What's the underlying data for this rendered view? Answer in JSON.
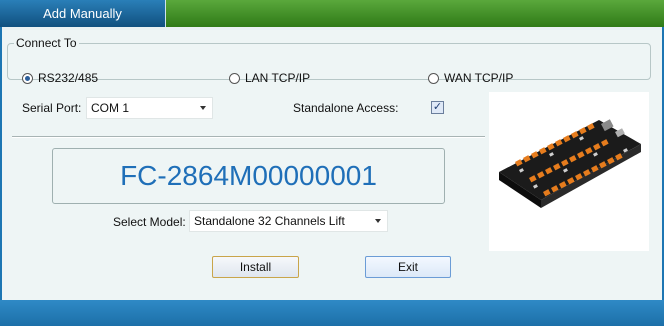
{
  "window": {
    "tab_title": "Add Manually"
  },
  "connect": {
    "legend": "Connect To",
    "options": [
      {
        "label": "RS232/485",
        "selected": true
      },
      {
        "label": "LAN TCP/IP",
        "selected": false
      },
      {
        "label": "WAN TCP/IP",
        "selected": false
      }
    ]
  },
  "serial": {
    "label": "Serial Port:",
    "value": "COM 1"
  },
  "standalone": {
    "label": "Standalone Access:",
    "checked": true
  },
  "device": {
    "serial_number": "FC-2864M00000001"
  },
  "model": {
    "label": "Select Model:",
    "value": "Standalone 32 Channels Lift"
  },
  "buttons": {
    "install": "Install",
    "exit": "Exit"
  },
  "colors": {
    "accent_blue": "#1f6fb8",
    "green_bar": "#2f7a17"
  }
}
